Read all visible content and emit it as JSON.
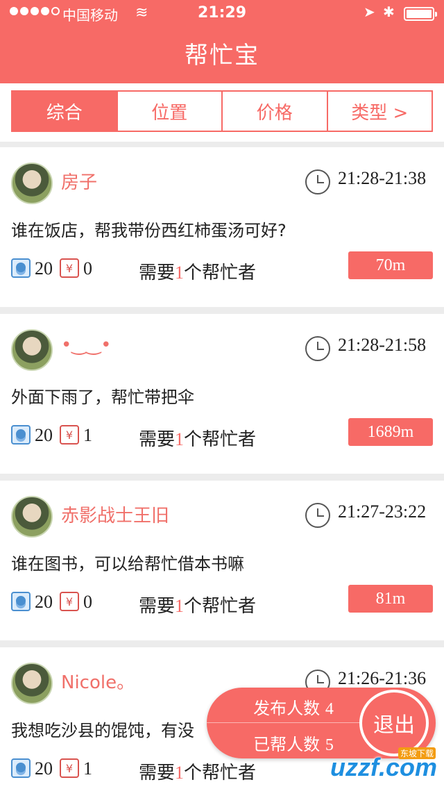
{
  "status_bar": {
    "carrier": "中国移动",
    "time": "21:29"
  },
  "header": {
    "title": "帮忙宝"
  },
  "tabs": [
    {
      "label": "综合",
      "active": true
    },
    {
      "label": "位置",
      "active": false
    },
    {
      "label": "价格",
      "active": false
    },
    {
      "label": "类型 >",
      "active": false
    }
  ],
  "posts": [
    {
      "user": "房子",
      "time": "21:28-21:38",
      "message": "谁在饭店，帮我带份西红柿蛋汤可好?",
      "coins": "20",
      "money": "0",
      "need_prefix": "需要",
      "need_count": "1",
      "need_suffix": "个帮忙者",
      "distance": "70m"
    },
    {
      "user": "•‿‿•",
      "time": "21:28-21:58",
      "message": "外面下雨了，帮忙带把伞",
      "coins": "20",
      "money": "1",
      "need_prefix": "需要",
      "need_count": "1",
      "need_suffix": "个帮忙者",
      "distance": "1689m"
    },
    {
      "user": "赤影战士王旧",
      "time": "21:27-23:22",
      "message": "谁在图书，可以给帮忙借本书嘛",
      "coins": "20",
      "money": "0",
      "need_prefix": "需要",
      "need_count": "1",
      "need_suffix": "个帮忙者",
      "distance": "81m"
    },
    {
      "user": "Nicole。",
      "time": "21:26-21:36",
      "message": "我想吃沙县的馄饨，有没",
      "coins": "20",
      "money": "1",
      "need_prefix": "需要",
      "need_count": "1",
      "need_suffix": "个帮忙者",
      "distance": ""
    }
  ],
  "floating": {
    "published_label": "发布人数",
    "published_count": "4",
    "helped_label": "已帮人数",
    "helped_count": "5",
    "logout_label": "退出"
  },
  "watermark": {
    "text": "uzzf.com",
    "sub": "东坡下载"
  },
  "colors": {
    "accent": "#f76a66",
    "coin_blue": "#4a8fd0",
    "yen_red": "#d9534f"
  }
}
